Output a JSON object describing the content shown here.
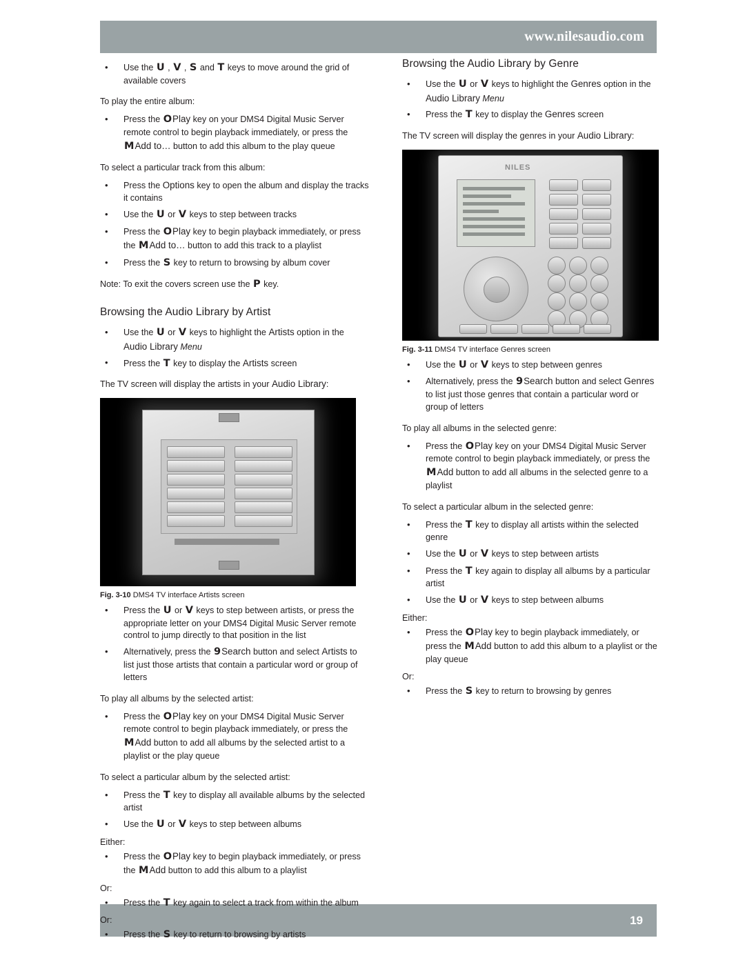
{
  "header": {
    "url": "www.nilesaudio.com"
  },
  "footer": {
    "page_number": "19"
  },
  "left_column": {
    "items": [
      {
        "type": "bullet",
        "parts": [
          {
            "t": "Use the "
          },
          {
            "k": "U"
          },
          {
            "t": " , "
          },
          {
            "k": "V"
          },
          {
            "t": " , "
          },
          {
            "k": "S"
          },
          {
            "t": " and "
          },
          {
            "k": "T"
          },
          {
            "t": " keys to move around the grid of available covers"
          }
        ]
      },
      {
        "type": "sub",
        "parts": [
          {
            "t": "To play the entire album:"
          }
        ]
      },
      {
        "type": "bullet",
        "parts": [
          {
            "t": "Press the "
          },
          {
            "k": "O"
          },
          {
            "kw": "Play"
          },
          {
            "t": " key on your DMS4 Digital Music Server remote control to begin playback immediately, or press the "
          },
          {
            "k": "M"
          },
          {
            "kw": "Add to…"
          },
          {
            "t": " button to add this album to the play queue"
          }
        ]
      },
      {
        "type": "sub",
        "parts": [
          {
            "t": "To select a particular track from this album:"
          }
        ]
      },
      {
        "type": "bullet",
        "parts": [
          {
            "t": "Press the "
          },
          {
            "kw": "Options"
          },
          {
            "t": " key to open the album and display the tracks it contains"
          }
        ]
      },
      {
        "type": "bullet",
        "parts": [
          {
            "t": "Use the "
          },
          {
            "k": "U"
          },
          {
            "t": " or "
          },
          {
            "k": "V"
          },
          {
            "t": " keys to step between tracks"
          }
        ]
      },
      {
        "type": "bullet",
        "parts": [
          {
            "t": "Press the "
          },
          {
            "k": "O"
          },
          {
            "kw": "Play"
          },
          {
            "t": " key to begin playback immediately, or press the "
          },
          {
            "k": "M"
          },
          {
            "kw": "Add to…"
          },
          {
            "t": " button to add this track to a playlist"
          }
        ]
      },
      {
        "type": "bullet",
        "parts": [
          {
            "t": "Press the "
          },
          {
            "k": "S"
          },
          {
            "t": " key to return to browsing by album cover"
          }
        ]
      },
      {
        "type": "para",
        "parts": [
          {
            "t": "Note: To exit the covers screen use the "
          },
          {
            "k": "P"
          },
          {
            "t": " key."
          }
        ]
      },
      {
        "type": "h2",
        "parts": [
          {
            "t": "Browsing the Audio Library by Artist"
          }
        ]
      },
      {
        "type": "bullet",
        "parts": [
          {
            "t": "Use the "
          },
          {
            "k": "U"
          },
          {
            "t": " or "
          },
          {
            "k": "V"
          },
          {
            "t": " keys to highlight the "
          },
          {
            "kw": "Artists"
          },
          {
            "t": " option in the "
          },
          {
            "kw": "Audio Library"
          },
          {
            "i": " Menu"
          }
        ]
      },
      {
        "type": "bullet",
        "parts": [
          {
            "t": "Press the "
          },
          {
            "k": "T"
          },
          {
            "t": " key to display the "
          },
          {
            "kw": "Artists"
          },
          {
            "t": " screen"
          }
        ]
      },
      {
        "type": "para",
        "parts": [
          {
            "t": "The TV screen will display the artists in your "
          },
          {
            "kw": "Audio Library"
          },
          {
            "t": ":"
          }
        ]
      },
      {
        "type": "figure",
        "id": "fig-3-10"
      },
      {
        "type": "caption",
        "num": "Fig. 3-10",
        "text": "DMS4 TV interface Artists screen"
      },
      {
        "type": "bullet",
        "parts": [
          {
            "t": "Press the "
          },
          {
            "k": "U"
          },
          {
            "t": " or "
          },
          {
            "k": "V"
          },
          {
            "t": " keys to step between artists, or press the appropriate letter on your DMS4 Digital Music Server remote control to jump directly to that position in the list"
          }
        ]
      },
      {
        "type": "bullet",
        "parts": [
          {
            "t": "Alternatively, press the "
          },
          {
            "k": "9"
          },
          {
            "kw": "Search"
          },
          {
            "t": " button and select "
          },
          {
            "kw": "Artists"
          },
          {
            "t": " to list just those artists that contain a particular word or group of letters"
          }
        ]
      },
      {
        "type": "sub",
        "parts": [
          {
            "t": "To play all albums by the selected artist:"
          }
        ]
      },
      {
        "type": "bullet",
        "parts": [
          {
            "t": "Press the "
          },
          {
            "k": "O"
          },
          {
            "kw": "Play"
          },
          {
            "t": " key on your DMS4 Digital Music Server remote control to begin playback immediately, or press the "
          },
          {
            "k": "M"
          },
          {
            "kw": "Add"
          },
          {
            "t": " button to add all albums by the selected artist to a playlist or the play queue"
          }
        ]
      },
      {
        "type": "sub",
        "parts": [
          {
            "t": "To select a particular album by the selected artist:"
          }
        ]
      },
      {
        "type": "bullet",
        "parts": [
          {
            "t": "Press the "
          },
          {
            "k": "T"
          },
          {
            "t": " key to display all available albums by the selected artist"
          }
        ]
      },
      {
        "type": "bullet",
        "parts": [
          {
            "t": "Use the "
          },
          {
            "k": "U"
          },
          {
            "t": " or "
          },
          {
            "k": "V"
          },
          {
            "t": " keys to step between albums"
          }
        ]
      },
      {
        "type": "tiny",
        "parts": [
          {
            "t": "Either:"
          }
        ]
      },
      {
        "type": "bullet",
        "parts": [
          {
            "t": "Press the "
          },
          {
            "k": "O"
          },
          {
            "kw": "Play"
          },
          {
            "t": " key to begin playback immediately, or press the "
          },
          {
            "k": "M"
          },
          {
            "kw": "Add"
          },
          {
            "t": " button to add this album to a playlist"
          }
        ]
      },
      {
        "type": "tiny",
        "parts": [
          {
            "t": "Or:"
          }
        ]
      },
      {
        "type": "bullet",
        "parts": [
          {
            "t": "Press the "
          },
          {
            "k": "T"
          },
          {
            "t": " key again to select a track from within the album"
          }
        ]
      },
      {
        "type": "tiny",
        "parts": [
          {
            "t": "Or:"
          }
        ]
      },
      {
        "type": "bullet",
        "parts": [
          {
            "t": "Press the "
          },
          {
            "k": "S"
          },
          {
            "t": " key to return to browsing by artists"
          }
        ]
      }
    ]
  },
  "right_column": {
    "items": [
      {
        "type": "h2-first",
        "parts": [
          {
            "t": "Browsing the Audio Library by Genre"
          }
        ]
      },
      {
        "type": "bullet",
        "parts": [
          {
            "t": "Use the "
          },
          {
            "k": "U"
          },
          {
            "t": " or "
          },
          {
            "k": "V"
          },
          {
            "t": " keys to highlight the "
          },
          {
            "kw": "Genres"
          },
          {
            "t": " option in the "
          },
          {
            "kw": "Audio Library"
          },
          {
            "i": " Menu"
          }
        ]
      },
      {
        "type": "bullet",
        "parts": [
          {
            "t": "Press the "
          },
          {
            "k": "T"
          },
          {
            "t": " key to display the "
          },
          {
            "kw": "Genres"
          },
          {
            "t": " screen"
          }
        ]
      },
      {
        "type": "para",
        "parts": [
          {
            "t": "The TV screen will display the genres in your "
          },
          {
            "kw": "Audio Library"
          },
          {
            "t": ":"
          }
        ]
      },
      {
        "type": "figure",
        "id": "fig-3-11"
      },
      {
        "type": "caption",
        "num": "Fig. 3-11",
        "text": "DMS4 TV interface Genres screen"
      },
      {
        "type": "bullet",
        "parts": [
          {
            "t": "Use the "
          },
          {
            "k": "U"
          },
          {
            "t": " or "
          },
          {
            "k": "V"
          },
          {
            "t": " keys to step between genres"
          }
        ]
      },
      {
        "type": "bullet",
        "parts": [
          {
            "t": "Alternatively, press the "
          },
          {
            "k": "9"
          },
          {
            "kw": "Search"
          },
          {
            "t": " button and select "
          },
          {
            "kw": "Genres"
          },
          {
            "t": " to list just those genres that contain a particular word or group of letters"
          }
        ]
      },
      {
        "type": "sub",
        "parts": [
          {
            "t": "To play all albums in the selected genre:"
          }
        ]
      },
      {
        "type": "bullet",
        "parts": [
          {
            "t": "Press the "
          },
          {
            "k": "O"
          },
          {
            "kw": "Play"
          },
          {
            "t": " key on your DMS4 Digital Music Server remote control to begin playback immediately, or press the "
          },
          {
            "k": "M"
          },
          {
            "kw": "Add"
          },
          {
            "t": " button to add all albums in the selected genre to a playlist"
          }
        ]
      },
      {
        "type": "sub",
        "parts": [
          {
            "t": "To select a particular album in the selected genre:"
          }
        ]
      },
      {
        "type": "bullet",
        "parts": [
          {
            "t": "Press the "
          },
          {
            "k": "T"
          },
          {
            "t": " key to display all artists within the selected genre"
          }
        ]
      },
      {
        "type": "bullet",
        "parts": [
          {
            "t": "Use the "
          },
          {
            "k": "U"
          },
          {
            "t": " or "
          },
          {
            "k": "V"
          },
          {
            "t": " keys to step between artists"
          }
        ]
      },
      {
        "type": "bullet",
        "parts": [
          {
            "t": "Press the "
          },
          {
            "k": "T"
          },
          {
            "t": " key again to display all albums by a particular artist"
          }
        ]
      },
      {
        "type": "bullet",
        "parts": [
          {
            "t": "Use the "
          },
          {
            "k": "U"
          },
          {
            "t": " or "
          },
          {
            "k": "V"
          },
          {
            "t": " keys to step between albums"
          }
        ]
      },
      {
        "type": "tiny",
        "parts": [
          {
            "t": "Either:"
          }
        ]
      },
      {
        "type": "bullet",
        "parts": [
          {
            "t": "Press the "
          },
          {
            "k": "O"
          },
          {
            "kw": "Play"
          },
          {
            "t": " key to begin playback immediately, or press the "
          },
          {
            "k": "M"
          },
          {
            "kw": "Add"
          },
          {
            "t": " button to add this album to a playlist or the play queue"
          }
        ]
      },
      {
        "type": "tiny",
        "parts": [
          {
            "t": "Or:"
          }
        ]
      },
      {
        "type": "bullet",
        "parts": [
          {
            "t": "Press the "
          },
          {
            "k": "S"
          },
          {
            "t": " key to return to browsing by genres"
          }
        ]
      }
    ]
  },
  "figures": {
    "fig_3_10": {
      "caption_num": "Fig. 3-10",
      "caption_text": "DMS4 TV interface Artists screen"
    },
    "fig_3_11": {
      "caption_num": "Fig. 3-11",
      "caption_text": "DMS4 TV interface Genres screen",
      "brand": "NILES"
    }
  },
  "colors": {
    "bar": "#9aa3a5",
    "text": "#231f20",
    "page_bg": "#ffffff"
  }
}
